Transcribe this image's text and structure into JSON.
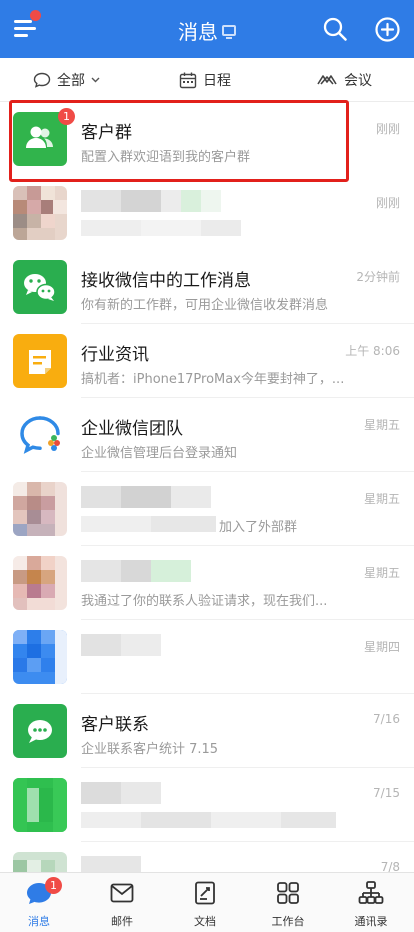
{
  "header": {
    "title": "消息",
    "colors": {
      "bar": "#2f7ce6",
      "badge": "#f04b46"
    }
  },
  "filters": [
    {
      "label": "全部",
      "icon": "chat-bubble-icon"
    },
    {
      "label": "日程",
      "icon": "calendar-icon"
    },
    {
      "label": "会议",
      "icon": "meeting-icon"
    }
  ],
  "chats": [
    {
      "name": "客户群",
      "sub": "配置入群欢迎语到我的客户群",
      "time": "刚刚",
      "badge": "1",
      "icon": "customer-group-icon"
    },
    {
      "name": "",
      "sub": "",
      "time": "刚刚",
      "icon": "blurred-avatar"
    },
    {
      "name": "接收微信中的工作消息",
      "sub": "你有新的工作群，可用企业微信收发群消息",
      "time": "2分钟前",
      "icon": "wechat-icon"
    },
    {
      "name": "行业资讯",
      "sub": "搞机者：iPhone17ProMax今年要封神了，...",
      "time": "上午 8:06",
      "icon": "news-icon"
    },
    {
      "name": "企业微信团队",
      "sub": "企业微信管理后台登录通知",
      "time": "星期五",
      "icon": "wecom-team-icon"
    },
    {
      "name": "",
      "sub": "加入了外部群",
      "time": "星期五",
      "icon": "blurred-avatar"
    },
    {
      "name": "",
      "sub": "我通过了你的联系人验证请求，现在我们...",
      "time": "星期五",
      "icon": "blurred-avatar"
    },
    {
      "name": "",
      "sub": "",
      "time": "星期四",
      "icon": "blurred-avatar"
    },
    {
      "name": "客户联系",
      "sub": "企业联系客户统计 7.15",
      "time": "7/16",
      "icon": "customer-contact-icon"
    },
    {
      "name": "",
      "sub": "",
      "time": "7/15",
      "icon": "blurred-avatar"
    },
    {
      "name": "",
      "sub": "",
      "time": "7/8",
      "icon": "blurred-avatar"
    }
  ],
  "tabs": [
    {
      "label": "消息",
      "badge": "1",
      "icon": "message-icon"
    },
    {
      "label": "邮件",
      "icon": "mail-icon"
    },
    {
      "label": "文档",
      "icon": "document-icon"
    },
    {
      "label": "工作台",
      "icon": "workbench-icon"
    },
    {
      "label": "通讯录",
      "icon": "contacts-icon"
    }
  ]
}
